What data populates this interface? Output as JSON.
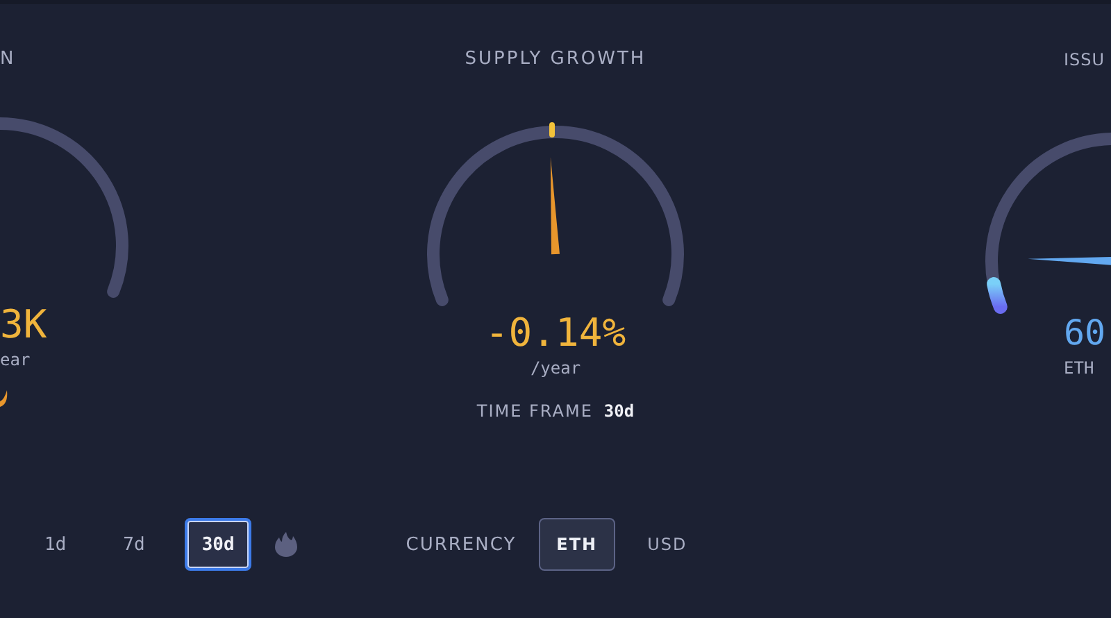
{
  "left_panel": {
    "title": "N",
    "value": "3K",
    "unit": "ear",
    "timeframes": [
      {
        "label": "1d",
        "selected": false
      },
      {
        "label": "7d",
        "selected": false
      },
      {
        "label": "30d",
        "selected": true
      }
    ]
  },
  "center_panel": {
    "title": "SUPPLY GROWTH",
    "value": "-0.14%",
    "unit": "/year",
    "time_frame_label": "TIME FRAME",
    "time_frame_value": "30d",
    "currency_label": "CURRENCY",
    "currencies": [
      {
        "label": "ETH",
        "selected": true
      },
      {
        "label": "USD",
        "selected": false
      }
    ]
  },
  "right_panel": {
    "title": "ISSU",
    "value": "60",
    "unit": "ETH"
  }
}
